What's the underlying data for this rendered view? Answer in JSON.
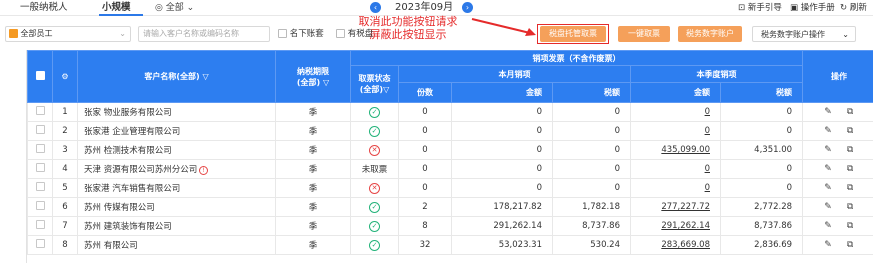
{
  "topbar": {
    "tabs": [
      {
        "label": "一般纳税人"
      },
      {
        "label": "小规模"
      }
    ],
    "all_select": "全部",
    "period": "2023年09月",
    "prev_icon": "chevron-left-icon",
    "next_icon": "chevron-right-icon",
    "links": {
      "guide": "新手引导",
      "manual": "操作手册",
      "refresh": "刷新"
    }
  },
  "annotation": {
    "line1": "取消此功能按钮请求",
    "line2": "屏蔽此按钮显示",
    "color": "#e52b2b"
  },
  "filter": {
    "staff_select": "全部员工",
    "search_placeholder": "请输入客户名称或编码名称",
    "under_account": "名下账套",
    "has_tax_disk": "有税盘",
    "btn_tax_custody": "税盘托管取票",
    "btn_one_click": "一键取票",
    "btn_digital_account": "税务数字账户",
    "btn_digital_ops": "税务数字账户操作"
  },
  "table": {
    "headers": {
      "customer": "客户名称(全部)",
      "tax_period": "纳税期限\n(全部)",
      "fetch_status": "取票状态\n(全部)",
      "sales_invoice": "销项发票（不含作废票）",
      "this_month": "本月销项",
      "this_quarter": "本季度销项",
      "count": "份数",
      "amount": "金额",
      "tax": "税额",
      "q_amount": "金额",
      "q_tax": "税额",
      "ops": "操作"
    },
    "rows": [
      {
        "no": "1",
        "name": "张家      物业服务有限公司",
        "period": "季",
        "status": "ok",
        "count": "0",
        "amount": "0",
        "tax": "0",
        "q_amount": "0",
        "q_tax": "0"
      },
      {
        "no": "2",
        "name": "张家港      企业管理有限公司",
        "period": "季",
        "status": "ok",
        "count": "0",
        "amount": "0",
        "tax": "0",
        "q_amount": "0",
        "q_tax": "0"
      },
      {
        "no": "3",
        "name": "苏州      检测技术有限公司",
        "period": "季",
        "status": "bad",
        "count": "0",
        "amount": "0",
        "tax": "0",
        "q_amount": "435,099.00",
        "q_tax": "4,351.00"
      },
      {
        "no": "4",
        "name": "天津      资源有限公司苏州分公司",
        "period": "季",
        "status": "text",
        "status_text": "未取票",
        "count": "0",
        "amount": "0",
        "tax": "0",
        "q_amount": "0",
        "q_tax": "0"
      },
      {
        "no": "5",
        "name": "张家港      汽车销售有限公司",
        "period": "季",
        "status": "bad",
        "count": "0",
        "amount": "0",
        "tax": "0",
        "q_amount": "0",
        "q_tax": "0"
      },
      {
        "no": "6",
        "name": "苏州      传媒有限公司",
        "period": "季",
        "status": "ok",
        "count": "2",
        "amount": "178,217.82",
        "tax": "1,782.18",
        "q_amount": "277,227.72",
        "q_tax": "2,772.28"
      },
      {
        "no": "7",
        "name": "苏州      建筑装饰有限公司",
        "period": "季",
        "status": "ok",
        "count": "8",
        "amount": "291,262.14",
        "tax": "8,737.86",
        "q_amount": "291,262.14",
        "q_tax": "8,737.86"
      },
      {
        "no": "8",
        "name": "苏州      有限公司",
        "period": "季",
        "status": "ok",
        "count": "32",
        "amount": "53,023.31",
        "tax": "530.24",
        "q_amount": "283,669.08",
        "q_tax": "2,836.69"
      }
    ]
  },
  "colors": {
    "header_blue": "#2d7ef0",
    "accent_orange": "#f5a05a",
    "ok_green": "#23b37a",
    "bad_red": "#e64545"
  }
}
